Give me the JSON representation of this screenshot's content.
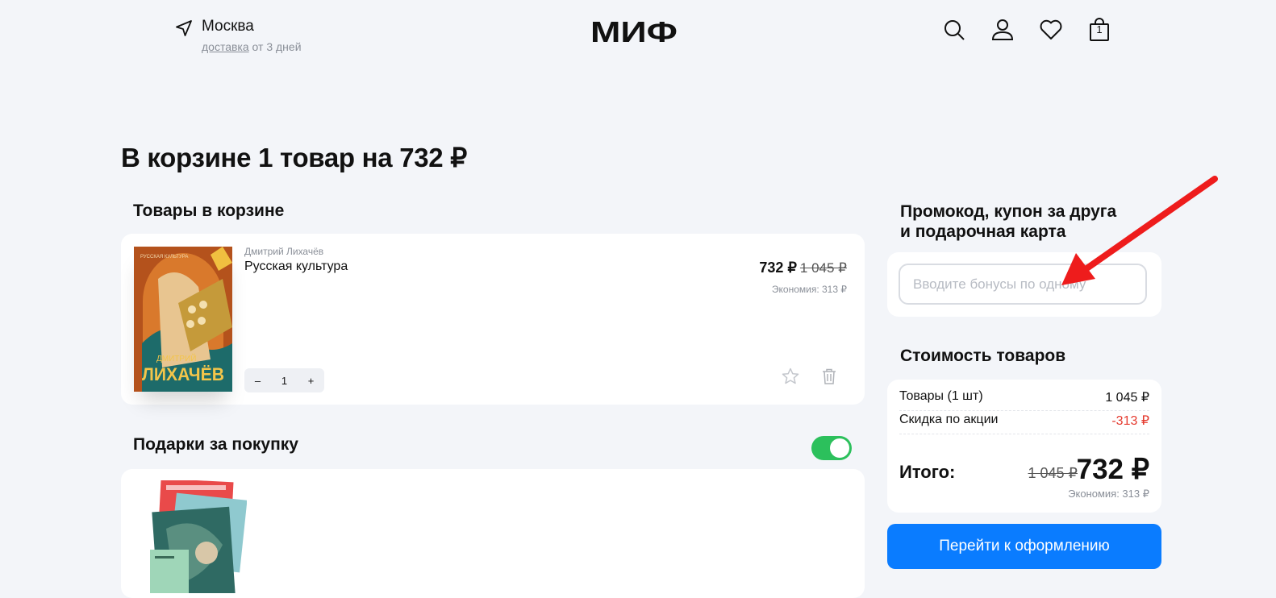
{
  "header": {
    "city": "Москва",
    "delivery_link": "доставка",
    "delivery_rest": " от 3 дней",
    "logo_text": "МИФ",
    "cart_count": "1"
  },
  "page_title": "В корзине 1 товар на 732 ₽",
  "cart_section": {
    "title": "Товары в корзине",
    "item": {
      "author": "Дмитрий Лихачёв",
      "title": "Русская культура",
      "price_new": "732 ₽",
      "price_old": "1 045 ₽",
      "economy": "Экономия: 313 ₽",
      "qty_minus": "–",
      "qty_value": "1",
      "qty_plus": "+",
      "cover_text_top": "РУССКАЯ КУЛЬТУРА",
      "cover_text_name": "ДМИТРИЙ",
      "cover_text_surname": "ЛИХАЧЁВ"
    }
  },
  "gifts_section": {
    "title": "Подарки за покупку",
    "toggle_on": true
  },
  "promo_section": {
    "title_line1": "Промокод, купон за друга",
    "title_line2": "и подарочная карта",
    "placeholder": "Вводите бонусы по одному"
  },
  "summary": {
    "title": "Стоимость товаров",
    "goods_label": "Товары (1 шт)",
    "goods_value": "1 045 ₽",
    "discount_label": "Скидка по акции",
    "discount_value": "-313 ₽",
    "total_label": "Итого:",
    "total_old": "1 045 ₽",
    "total_new": "732 ₽",
    "total_economy": "Экономия: 313 ₽"
  },
  "checkout_label": "Перейти к оформлению",
  "colors": {
    "accent": "#0a7cff",
    "toggle": "#2cc05c",
    "discount": "#e53a2e",
    "annotation_arrow": "#ee1c1c"
  }
}
